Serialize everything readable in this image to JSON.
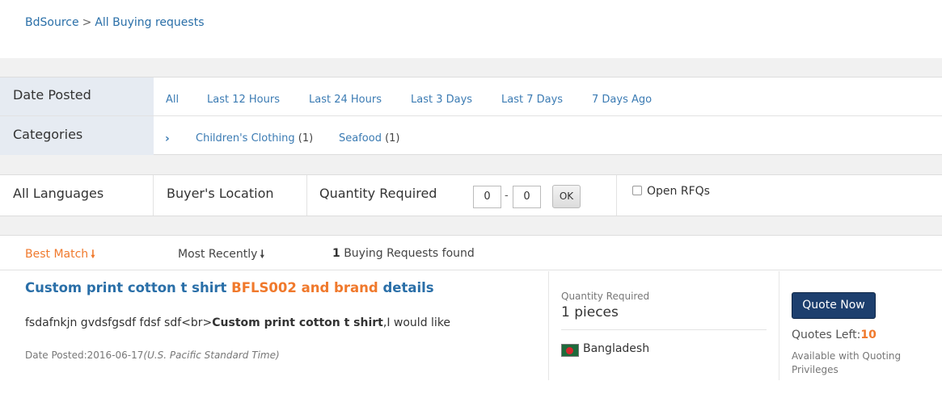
{
  "breadcrumb": {
    "home": "BdSource",
    "separator": ">",
    "current": "All Buying requests"
  },
  "filters": {
    "date_label": "Date Posted",
    "date_options": [
      "All",
      "Last 12 Hours",
      "Last 24 Hours",
      "Last 3 Days",
      "Last 7 Days",
      "7 Days Ago"
    ],
    "categories_label": "Categories",
    "categories": [
      {
        "name": "Children's Clothing",
        "count": "(1)"
      },
      {
        "name": "Seafood",
        "count": "(1)"
      }
    ]
  },
  "bar2": {
    "languages": "All Languages",
    "location": "Buyer's Location",
    "quantity_label": "Quantity Required",
    "qty_min": "0",
    "qty_max": "0",
    "dash": "-",
    "ok": "OK",
    "open_rfqs": "Open RFQs"
  },
  "sort": {
    "best": "Best Match",
    "recent": "Most Recently",
    "found_count": "1",
    "found_text": "Buying Requests found"
  },
  "item": {
    "title_part1": "Custom print cotton t shirt",
    "title_part2": "BFLS002 and brand",
    "title_part3": "details",
    "desc_prefix": "fsdafnkjn gvdsfgsdf fdsf sdf<br>",
    "desc_bold": "Custom print cotton t shirt",
    "desc_suffix": ",I would like",
    "date_label": "Date Posted:",
    "date_value": "2016-06-17",
    "date_tz": "(U.S. Pacific Standard Time)",
    "qty_label": "Quantity Required",
    "qty_value": "1 pieces",
    "country": "Bangladesh",
    "quote_button": "Quote Now",
    "quotes_left_label": "Quotes Left:",
    "quotes_left_value": "10",
    "availability": "Available with Quoting Privileges"
  },
  "colors": {
    "link": "#2a6fa8",
    "accent": "#f0792c",
    "quote_button": "#1d3f6e"
  }
}
